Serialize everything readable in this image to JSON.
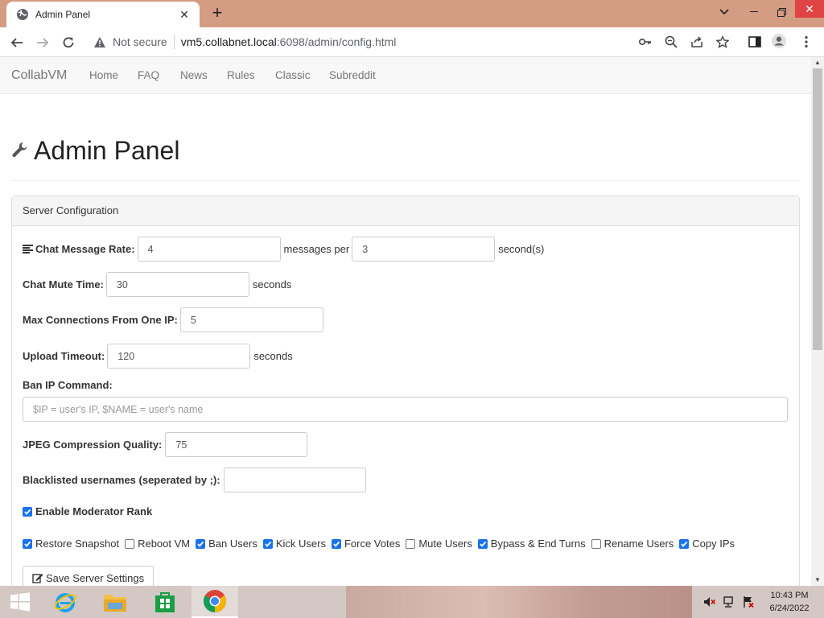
{
  "browser": {
    "tab_title": "Admin Panel",
    "security_label": "Not secure",
    "url_host": "vm5.collabnet.local",
    "url_path": ":6098/admin/config.html"
  },
  "site_nav": {
    "brand": "CollabVM",
    "links": [
      "Home",
      "FAQ",
      "News",
      "Rules",
      "Classic",
      "Subreddit"
    ]
  },
  "page": {
    "title": "Admin Panel",
    "panel_heading": "Server Configuration"
  },
  "form": {
    "chat_rate": {
      "label": "Chat Message Rate:",
      "messages": "4",
      "middle_text": "messages per",
      "seconds": "3",
      "suffix": "second(s)"
    },
    "mute_time": {
      "label": "Chat Mute Time:",
      "value": "30",
      "suffix": "seconds"
    },
    "max_connections": {
      "label": "Max Connections From One IP:",
      "value": "5"
    },
    "upload_timeout": {
      "label": "Upload Timeout:",
      "value": "120",
      "suffix": "seconds"
    },
    "ban_command": {
      "label": "Ban IP Command:",
      "value": "",
      "placeholder": "$IP = user's IP, $NAME = user's name"
    },
    "jpeg_quality": {
      "label": "JPEG Compression Quality:",
      "value": "75"
    },
    "blacklist": {
      "label": "Blacklisted usernames (seperated by ;):",
      "value": ""
    },
    "enable_moderator": {
      "label": "Enable Moderator Rank",
      "checked": true
    },
    "permissions": [
      {
        "label": "Restore Snapshot",
        "checked": true
      },
      {
        "label": "Reboot VM",
        "checked": false
      },
      {
        "label": "Ban Users",
        "checked": true
      },
      {
        "label": "Kick Users",
        "checked": true
      },
      {
        "label": "Force Votes",
        "checked": true
      },
      {
        "label": "Mute Users",
        "checked": false
      },
      {
        "label": "Bypass & End Turns",
        "checked": true
      },
      {
        "label": "Rename Users",
        "checked": false
      },
      {
        "label": "Copy IPs",
        "checked": true
      }
    ],
    "save_button": "Save Server Settings"
  },
  "taskbar": {
    "time": "10:43 PM",
    "date": "6/24/2022"
  },
  "colors": {
    "checkbox_on": "#1a73e8",
    "close_button": "#e04343",
    "titlebar": "#d49c83"
  }
}
